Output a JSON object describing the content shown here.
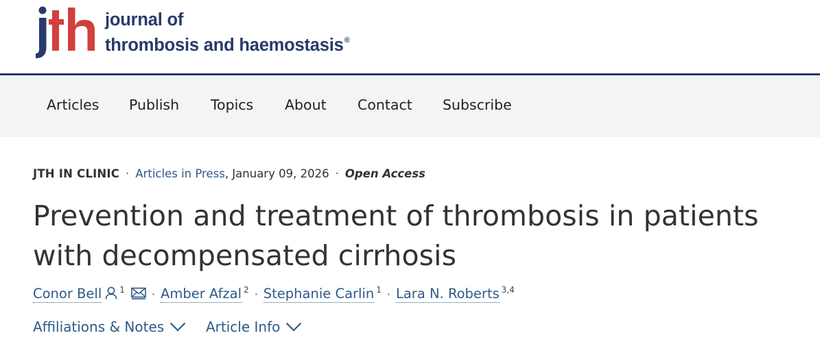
{
  "logo": {
    "mark_text": "jth",
    "line1": "journal of",
    "line2": "thrombosis and haemostasis",
    "registered": "®",
    "colors": {
      "brand_navy": "#273a6b",
      "brand_red": "#d1403c"
    }
  },
  "nav": {
    "items": [
      {
        "label": "Articles"
      },
      {
        "label": "Publish"
      },
      {
        "label": "Topics"
      },
      {
        "label": "About"
      },
      {
        "label": "Contact"
      },
      {
        "label": "Subscribe"
      }
    ]
  },
  "article": {
    "section": "JTH IN CLINIC",
    "issue_link": "Articles in Press",
    "date": ", January 09, 2026",
    "access": "Open Access",
    "title": "Prevention and treatment of thrombosis in patients with decompensated cirrhosis",
    "authors": [
      {
        "name": "Conor Bell",
        "affil": "1",
        "icons": [
          "person-icon",
          "mail-icon"
        ]
      },
      {
        "name": "Amber Afzal",
        "affil": "2"
      },
      {
        "name": "Stephanie Carlin",
        "affil": "1"
      },
      {
        "name": "Lara N. Roberts",
        "affil": "3,4"
      }
    ],
    "affiliations_toggle": "Affiliations & Notes",
    "article_info_toggle": "Article Info",
    "link_color": "#2e5a88"
  }
}
